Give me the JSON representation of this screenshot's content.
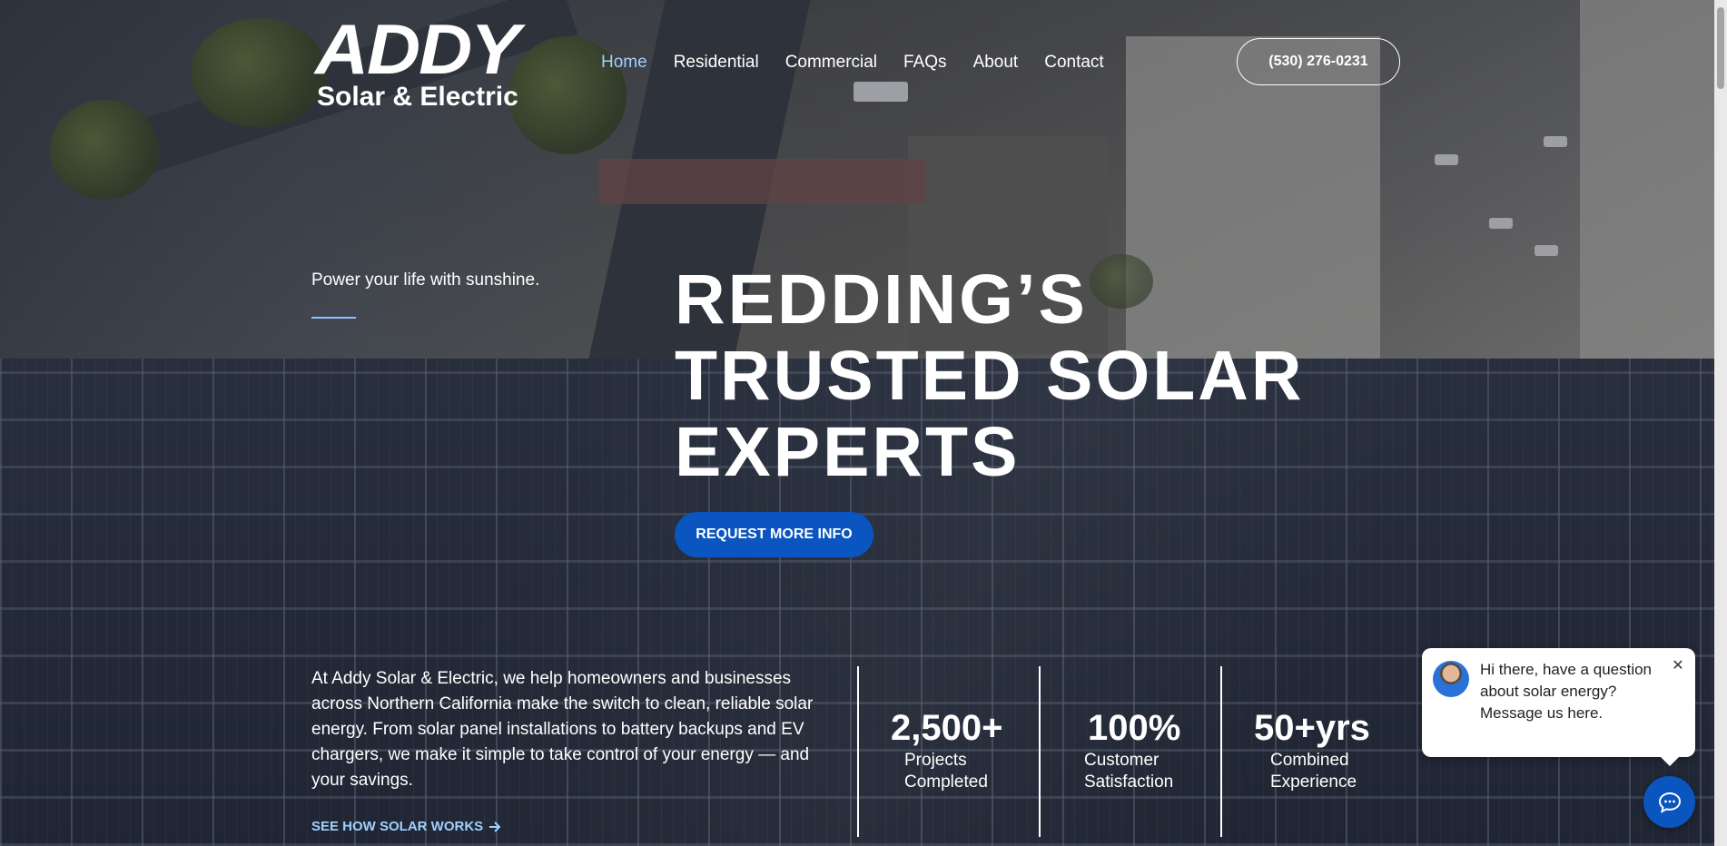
{
  "header": {
    "logo": {
      "main": "ADDY",
      "sub": "Solar & Electric"
    },
    "nav": [
      {
        "label": "Home",
        "active": true
      },
      {
        "label": "Residential",
        "active": false
      },
      {
        "label": "Commercial",
        "active": false
      },
      {
        "label": "FAQs",
        "active": false
      },
      {
        "label": "About",
        "active": false
      },
      {
        "label": "Contact",
        "active": false
      }
    ],
    "phone": "(530) 276-0231"
  },
  "hero": {
    "tagline": "Power your life with sunshine.",
    "title_lines": [
      "REDDING’S",
      "TRUSTED SOLAR",
      "EXPERTS"
    ],
    "cta": "REQUEST MORE INFO"
  },
  "intro": {
    "text": "At Addy Solar & Electric, we help homeowners and businesses across Northern California make the switch to clean, reliable solar energy. From solar panel installations to battery backups and EV chargers, we make it simple to take control of your energy — and your savings.",
    "link": "SEE HOW SOLAR WORKS"
  },
  "stats": [
    {
      "value": "2,500+",
      "label": "Projects Completed"
    },
    {
      "value": "100%",
      "label": "Customer Satisfaction"
    },
    {
      "value": "50+yrs",
      "label": "Combined Experience"
    }
  ],
  "chat": {
    "message": "Hi there, have a question about solar energy? Message us here.",
    "close": "✕"
  },
  "colors": {
    "accent_blue": "#0a55c0",
    "link_light_blue": "#9fd0ff",
    "text_white": "#ffffff"
  },
  "icons": [
    "arrow-right-icon",
    "chat-icon",
    "close-icon",
    "avatar"
  ]
}
